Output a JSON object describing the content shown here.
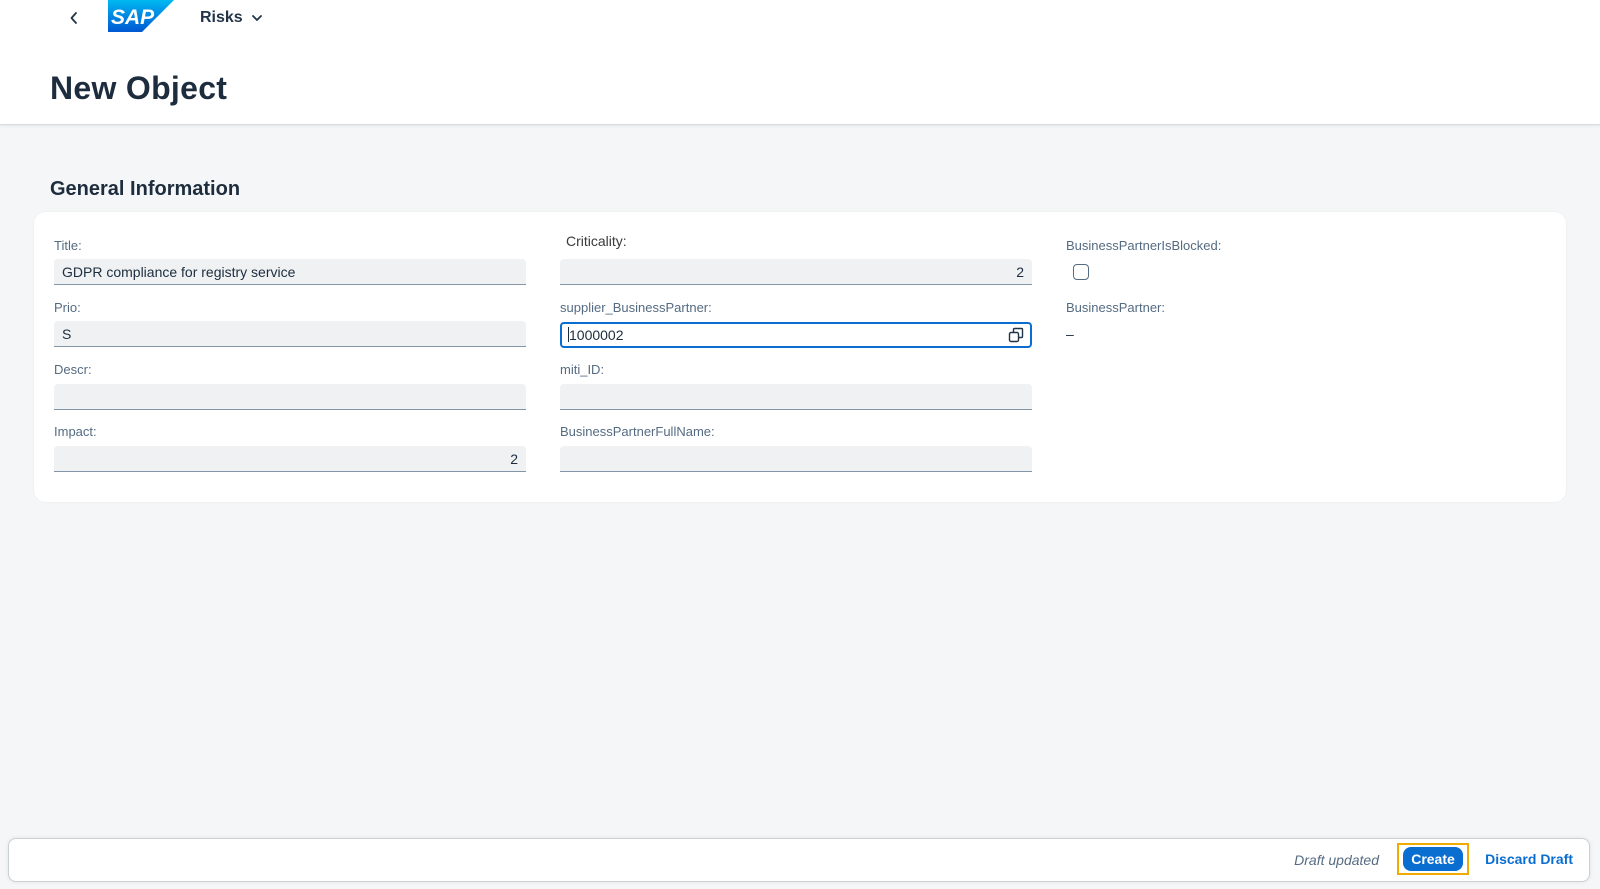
{
  "header": {
    "logo_text": "SAP",
    "app_title": "Risks",
    "page_title": "New Object"
  },
  "section": {
    "title": "General Information"
  },
  "fields": {
    "title": {
      "label": "Title:",
      "value": "GDPR compliance for registry service"
    },
    "prio": {
      "label": "Prio:",
      "value": "S"
    },
    "descr": {
      "label": "Descr:",
      "value": ""
    },
    "impact": {
      "label": "Impact:",
      "value": "2"
    },
    "criticality": {
      "label": "Criticality:",
      "value": "2"
    },
    "supplier_business_partner": {
      "label": "supplier_BusinessPartner:",
      "value": "1000002"
    },
    "miti_id": {
      "label": "miti_ID:",
      "value": ""
    },
    "business_partner_full_name": {
      "label": "BusinessPartnerFullName:",
      "value": ""
    },
    "business_partner_is_blocked": {
      "label": "BusinessPartnerIsBlocked:",
      "checked": false
    },
    "business_partner": {
      "label": "BusinessPartner:",
      "value": "–"
    }
  },
  "footer": {
    "status": "Draft updated",
    "create_label": "Create",
    "discard_label": "Discard Draft"
  },
  "colors": {
    "brand_blue": "#0a6ed1",
    "highlight": "#f0ab00",
    "background": "#f5f6f7"
  }
}
